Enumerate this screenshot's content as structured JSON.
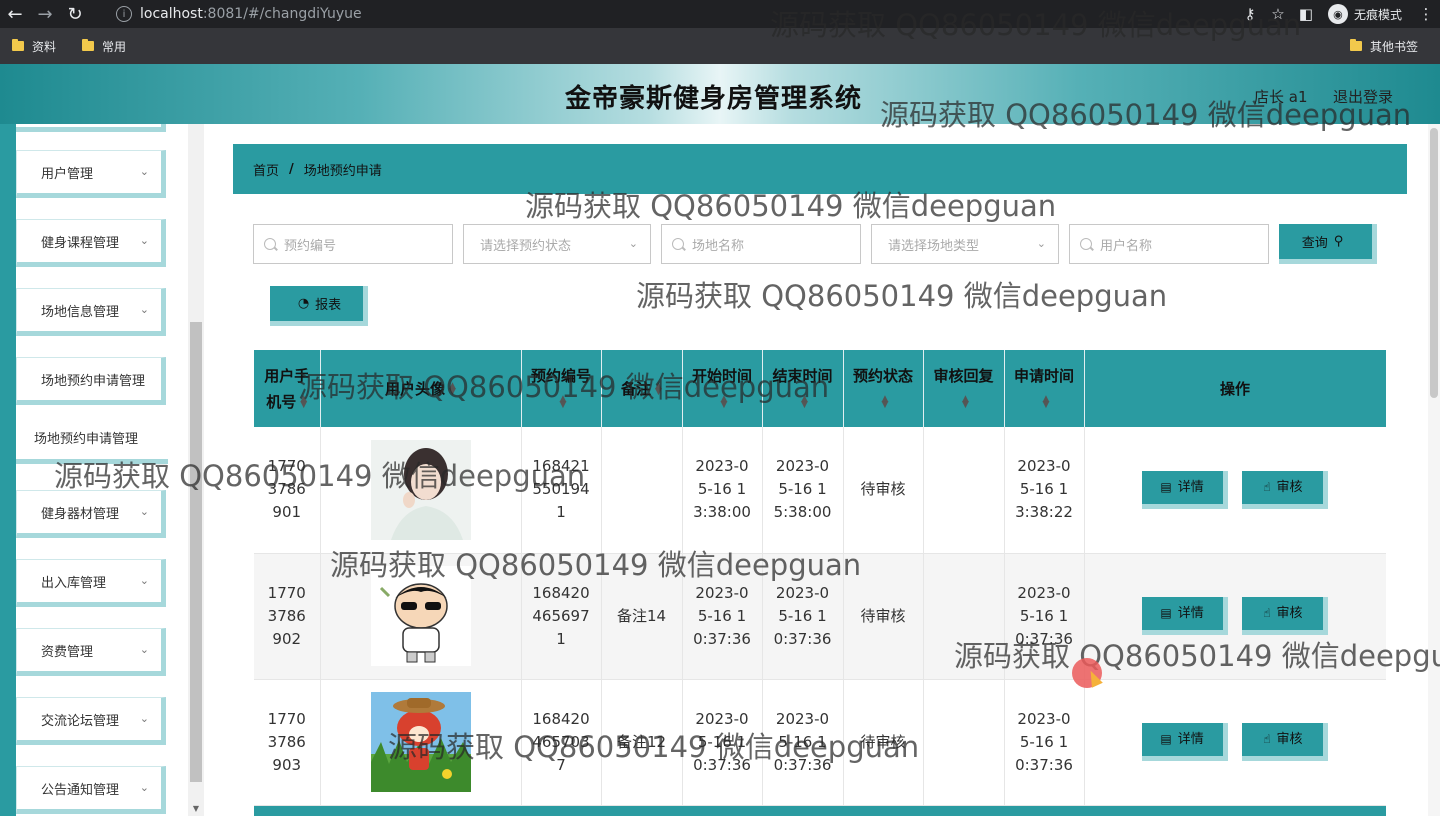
{
  "browser": {
    "url_host": "localhost",
    "url_path": ":8081/#/changdiYuyue",
    "incognito_label": "无痕模式",
    "bookmarks": [
      "资料",
      "常用"
    ],
    "other_bookmarks": "其他书签"
  },
  "header": {
    "title": "金帝豪斯健身房管理系统",
    "user": "店长 a1",
    "logout": "退出登录"
  },
  "sidebar": {
    "items": [
      {
        "label": "用户管理",
        "chevron": "⌄"
      },
      {
        "label": "健身课程管理",
        "chevron": "⌄"
      },
      {
        "label": "场地信息管理",
        "chevron": "⌄"
      },
      {
        "label": "场地预约申请管理",
        "chevron": ""
      },
      {
        "label": "场地预约申请管理",
        "chevron": ""
      },
      {
        "label": "健身器材管理",
        "chevron": "⌄"
      },
      {
        "label": "出入库管理",
        "chevron": "⌄"
      },
      {
        "label": "资费管理",
        "chevron": "⌄"
      },
      {
        "label": "交流论坛管理",
        "chevron": "⌄"
      },
      {
        "label": "公告通知管理",
        "chevron": "⌄"
      }
    ]
  },
  "breadcrumb": {
    "home": "首页",
    "sep": "/",
    "current": "场地预约申请"
  },
  "search": {
    "booking_no_placeholder": "预约编号",
    "status_placeholder": "请选择预约状态",
    "venue_name_placeholder": "场地名称",
    "venue_type_placeholder": "请选择场地类型",
    "username_placeholder": "用户名称",
    "query_label": "查询",
    "report_label": "报表"
  },
  "table": {
    "headers": [
      "用户手机号",
      "用户头像",
      "预约编号",
      "备注",
      "开始时间",
      "结束时间",
      "预约状态",
      "审核回复",
      "申请时间",
      "操作"
    ],
    "detail_label": "详情",
    "review_label": "审核",
    "rows": [
      {
        "phone": "17703786901",
        "booking_no": "1684215501941",
        "note": "",
        "start": "2023-05-16 13:38:00",
        "end": "2023-05-16 15:38:00",
        "status": "待审核",
        "reply": "",
        "applied": "2023-05-16 13:38:22"
      },
      {
        "phone": "17703786902",
        "booking_no": "1684204656971",
        "note": "备注14",
        "start": "2023-05-16 10:37:36",
        "end": "2023-05-16 10:37:36",
        "status": "待审核",
        "reply": "",
        "applied": "2023-05-16 10:37:36"
      },
      {
        "phone": "17703786903",
        "booking_no": "1684204657037",
        "note": "备注12",
        "start": "2023-05-16 10:37:36",
        "end": "2023-05-16 10:37:36",
        "status": "待审核",
        "reply": "",
        "applied": "2023-05-16 10:37:36"
      }
    ]
  },
  "watermark": "源码获取 QQ86050149 微信deepguan",
  "colors": {
    "teal": "#2a9ba1",
    "teal_light": "#a6d8db"
  }
}
